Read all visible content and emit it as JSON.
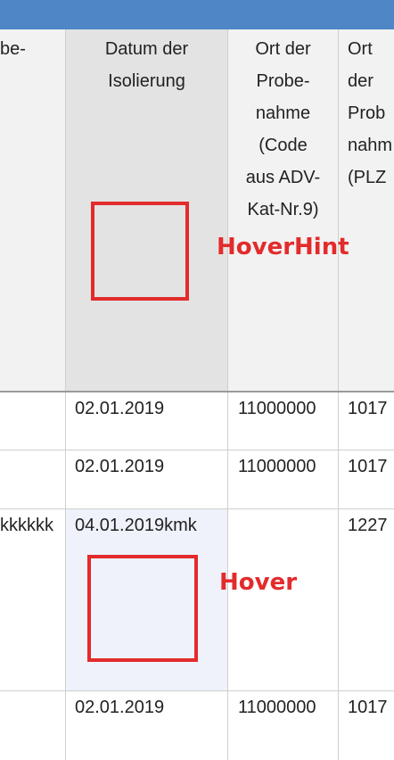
{
  "table": {
    "headers": [
      "be-",
      "Datum der\nIsolierung",
      "Ort der\nProbe-\nnahme\n(Code\naus ADV-\nKat-Nr.9)",
      "Ort\nder\nProb\nnahm\n(PLZ"
    ],
    "rows": [
      [
        "",
        "02.01.2019",
        "11000000",
        "1017"
      ],
      [
        "",
        "02.01.2019",
        "11000000",
        "1017"
      ],
      [
        "kkkkkk",
        "04.01.2019kmk",
        "",
        "1227"
      ],
      [
        "",
        "02.01.2019",
        "11000000",
        "1017"
      ]
    ]
  },
  "annotations": {
    "header_hint": "HoverHint",
    "row_hover": "Hover"
  },
  "colors": {
    "topbar": "#4f86c6",
    "annotation_red": "#e32b2b",
    "hover_cell": "#eff2fb",
    "header_hover": "#e3e3e3"
  }
}
